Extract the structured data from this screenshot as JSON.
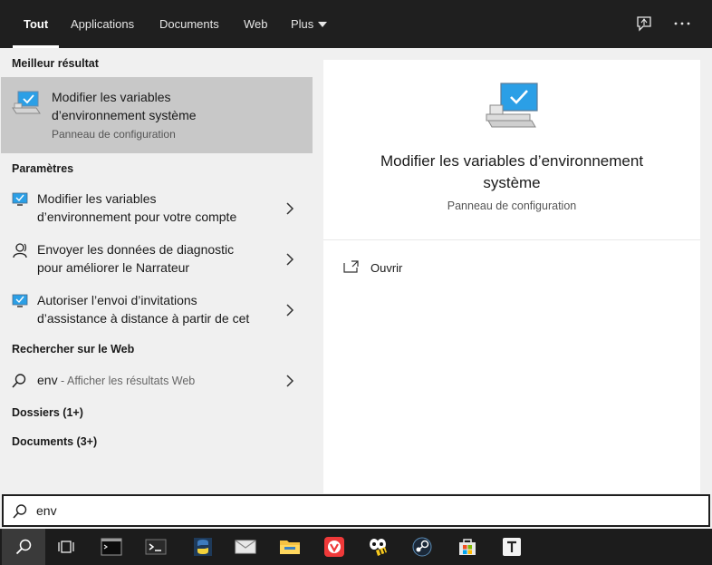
{
  "nav": {
    "tabs": [
      {
        "label": "Tout"
      },
      {
        "label": "Applications"
      },
      {
        "label": "Documents"
      },
      {
        "label": "Web"
      },
      {
        "label": "Plus"
      }
    ],
    "tools": [
      "feedback-icon",
      "more-icon"
    ]
  },
  "best": {
    "heading": "Meilleur résultat",
    "title_line1": "Modifier les variables",
    "title_line2": "d’environnement système",
    "subtitle": "Panneau de configuration"
  },
  "settings": {
    "heading": "Paramètres",
    "items": [
      {
        "line1": "Modifier les variables",
        "line2": "d’environnement pour votre compte",
        "icon": "monitor-icon"
      },
      {
        "line1": "Envoyer les données de diagnostic",
        "line2": "pour améliorer le Narrateur",
        "icon": "narrator-icon"
      },
      {
        "line1": "Autoriser l’envoi d’invitations",
        "line2": "d’assistance à distance à partir de cet",
        "icon": "monitor-icon"
      }
    ]
  },
  "web": {
    "heading": "Rechercher sur le Web",
    "query": "env",
    "hint": " - Afficher les résultats Web"
  },
  "folders": {
    "label": "Dossiers (1+)"
  },
  "documents": {
    "label": "Documents (3+)"
  },
  "preview": {
    "title_line1": "Modifier les variables d’environnement",
    "title_line2": "système",
    "subtitle": "Panneau de configuration",
    "open_label": "Ouvrir"
  },
  "search": {
    "value": "env"
  },
  "taskbar": {
    "apps": [
      "search-icon",
      "task-view-icon",
      "command-prompt-icon",
      "terminal-icon",
      "python-icon",
      "mail-icon",
      "file-explorer-icon",
      "vivaldi-icon",
      "bee-app-icon",
      "steam-icon",
      "store-icon",
      "typora-icon"
    ]
  },
  "colors": {
    "nav_bg": "#1f1f1f",
    "panel_bg": "#f0f0f0",
    "selected_bg": "#c8c8c8",
    "accent": "#0078d7"
  }
}
